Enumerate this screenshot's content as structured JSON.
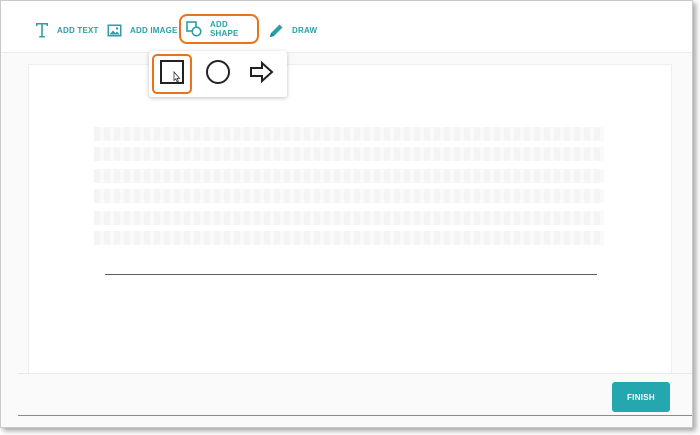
{
  "toolbar": {
    "add_text": "ADD TEXT",
    "add_image": "ADD IMAGE",
    "add_shape": "ADD SHAPE",
    "draw": "DRAW"
  },
  "shape_menu": {
    "options": [
      {
        "icon": "square-icon",
        "selected": true
      },
      {
        "icon": "circle-icon",
        "selected": false
      },
      {
        "icon": "arrow-right-icon",
        "selected": false
      }
    ]
  },
  "footer": {
    "finish_label": "FINISH"
  },
  "colors": {
    "accent": "#24a7ae",
    "highlight": "#e8731c"
  }
}
